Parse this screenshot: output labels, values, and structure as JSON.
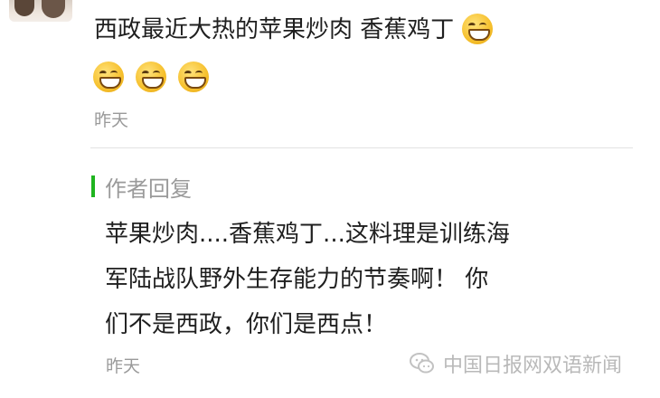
{
  "comment": {
    "text": "西政最近大热的苹果炒肉 香蕉鸡丁",
    "time": "昨天",
    "emojis": [
      "grin-emoji",
      "grin-emoji",
      "grin-emoji",
      "grin-emoji"
    ]
  },
  "reply": {
    "title": "作者回复",
    "lines": [
      "苹果炒肉....香蕉鸡丁...这料理是训练海",
      "军陆战队野外生存能力的节奏啊！ 你",
      "们不是西政，你们是西点！"
    ],
    "time": "昨天"
  },
  "watermark": {
    "text": "中国日报网双语新闻",
    "icon": "wechat-icon"
  },
  "colors": {
    "accent": "#1fb41f",
    "meta": "#9a9a9a",
    "text": "#1f1f1f"
  }
}
